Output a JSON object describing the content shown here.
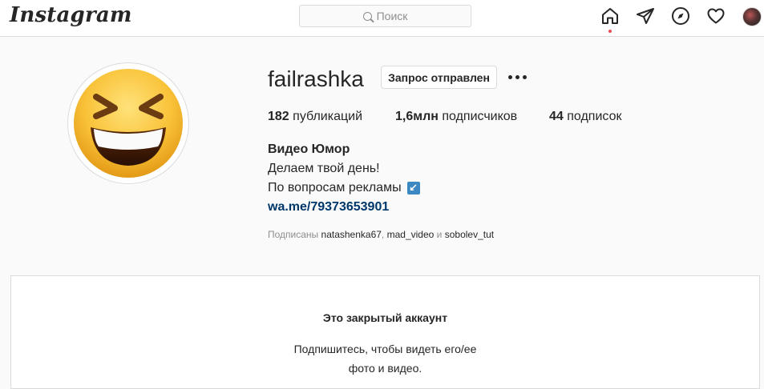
{
  "topbar": {
    "logo": "Instagram",
    "search_placeholder": "Поиск",
    "icons": [
      "home-icon",
      "direct-icon",
      "explore-icon",
      "heart-icon",
      "profile-avatar"
    ]
  },
  "profile": {
    "username": "failrashka",
    "request_button": "Запрос отправлен",
    "stats": [
      {
        "value": "182",
        "label": "публикаций"
      },
      {
        "value": "1,6млн",
        "label": "подписчиков"
      },
      {
        "value": "44",
        "label": "подписок"
      }
    ],
    "bio": {
      "name": "Видео Юмор",
      "line1": "Делаем твой день!",
      "line2": "По вопросам рекламы",
      "line2_emoji": "↙",
      "link": "wa.me/79373653901"
    },
    "followed_by": {
      "prefix": "Подписаны",
      "users": [
        "natashenka67",
        "mad_video",
        "sobolev_tut"
      ],
      "separator": ",",
      "conjunction": "и"
    }
  },
  "private": {
    "title": "Это закрытый аккаунт",
    "line1": "Подпишитесь, чтобы видеть его/ее",
    "line2": "фото и видео."
  },
  "colors": {
    "link": "#00376b",
    "notification_dot": "#ed4956",
    "border": "#dbdbdb",
    "muted": "#8e8e8e"
  }
}
